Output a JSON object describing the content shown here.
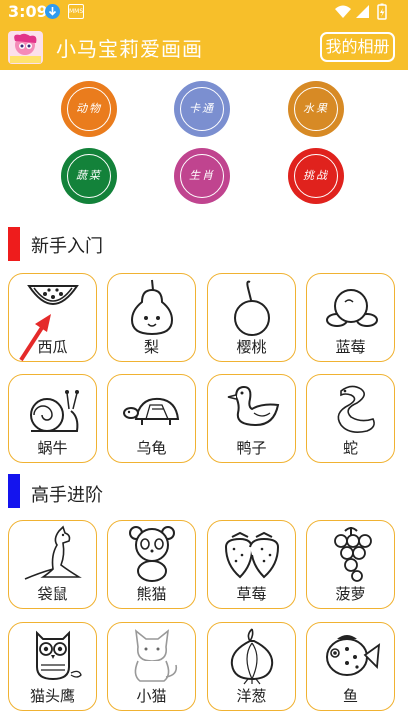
{
  "status_bar": {
    "time": "3:09",
    "mms_text": "MMS"
  },
  "app_bar": {
    "title": "小马宝莉爱画画",
    "album_button": "我的相册"
  },
  "categories": [
    {
      "label": "动物",
      "color": "#ea7c1d"
    },
    {
      "label": "卡通",
      "color": "#7b8fd0"
    },
    {
      "label": "水果",
      "color": "#d78a25"
    },
    {
      "label": "蔬菜",
      "color": "#13823a"
    },
    {
      "label": "生肖",
      "color": "#c0448f"
    },
    {
      "label": "挑战",
      "color": "#e0221d"
    }
  ],
  "sections": [
    {
      "title": "新手入门",
      "color": "#ee1c1c",
      "items": [
        "西瓜",
        "梨",
        "樱桃",
        "蓝莓",
        "蜗牛",
        "乌龟",
        "鸭子",
        "蛇"
      ]
    },
    {
      "title": "高手进阶",
      "color": "#1414ee",
      "items": [
        "袋鼠",
        "熊猫",
        "草莓",
        "菠萝",
        "猫头鹰",
        "小猫",
        "洋葱",
        "鱼"
      ]
    }
  ]
}
